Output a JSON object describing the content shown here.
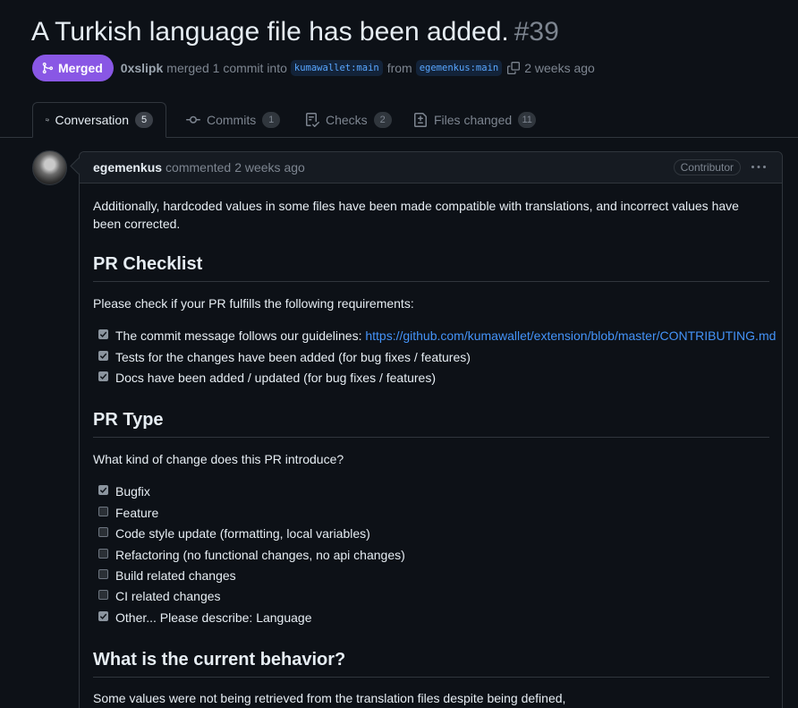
{
  "pr": {
    "title": "A Turkish language file has been added.",
    "number": "#39",
    "state": "Merged",
    "author": "0xslipk",
    "merged_text": "merged 1 commit into",
    "base_branch": "kumawallet:main",
    "from_text": "from",
    "head_branch": "egemenkus:main",
    "time": "2 weeks ago"
  },
  "tabs": [
    {
      "label": "Conversation",
      "count": "5",
      "icon": "comment-discussion-icon",
      "selected": true
    },
    {
      "label": "Commits",
      "count": "1",
      "icon": "git-commit-icon",
      "selected": false
    },
    {
      "label": "Checks",
      "count": "2",
      "icon": "checklist-icon",
      "selected": false
    },
    {
      "label": "Files changed",
      "count": "11",
      "icon": "file-diff-icon",
      "selected": false
    }
  ],
  "comment": {
    "author": "egemenkus",
    "action": "commented",
    "time": "2 weeks ago",
    "role": "Contributor",
    "intro": "Additionally, hardcoded values in some files have been made compatible with translations, and incorrect values have been corrected.",
    "checklist_heading": "PR Checklist",
    "checklist_intro": "Please check if your PR fulfills the following requirements:",
    "checklist": [
      {
        "text": "The commit message follows our guidelines: ",
        "link": "https://github.com/kumawallet/extension/blob/master/CONTRIBUTING.md",
        "checked": true
      },
      {
        "text": "Tests for the changes have been added (for bug fixes / features)",
        "checked": true
      },
      {
        "text": "Docs have been added / updated (for bug fixes / features)",
        "checked": true
      }
    ],
    "type_heading": "PR Type",
    "type_intro": "What kind of change does this PR introduce?",
    "types": [
      {
        "text": "Bugfix",
        "checked": true
      },
      {
        "text": "Feature",
        "checked": false
      },
      {
        "text": "Code style update (formatting, local variables)",
        "checked": false
      },
      {
        "text": "Refactoring (no functional changes, no api changes)",
        "checked": false
      },
      {
        "text": "Build related changes",
        "checked": false
      },
      {
        "text": "CI related changes",
        "checked": false
      },
      {
        "text": "Other... Please describe: Language",
        "checked": true
      }
    ],
    "behavior_heading": "What is the current behavior?",
    "behavior_text": "Some values were not being retrieved from the translation files despite being defined,"
  },
  "colors": {
    "background": "#0d1117",
    "merged": "#8957e5",
    "link": "#4493f8",
    "border": "#30363d"
  }
}
